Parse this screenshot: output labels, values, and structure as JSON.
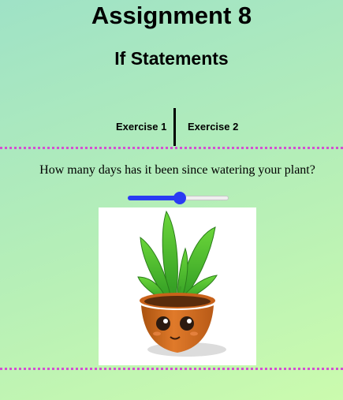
{
  "page": {
    "title": "Assignment 8",
    "subtitle": "If Statements"
  },
  "tabs": [
    {
      "label": "Exercise 1"
    },
    {
      "label": "Exercise 2"
    }
  ],
  "exercise": {
    "question": "How many days has it been since watering your plant?",
    "slider": {
      "value_fraction": 0.45
    }
  },
  "image": {
    "icon": "potted-plant-icon"
  },
  "colors": {
    "accent": "#2a3bf3",
    "divider_dots": "#d24fd2",
    "background_top": "#9fe2c6",
    "background_bottom": "#cbfbae"
  }
}
